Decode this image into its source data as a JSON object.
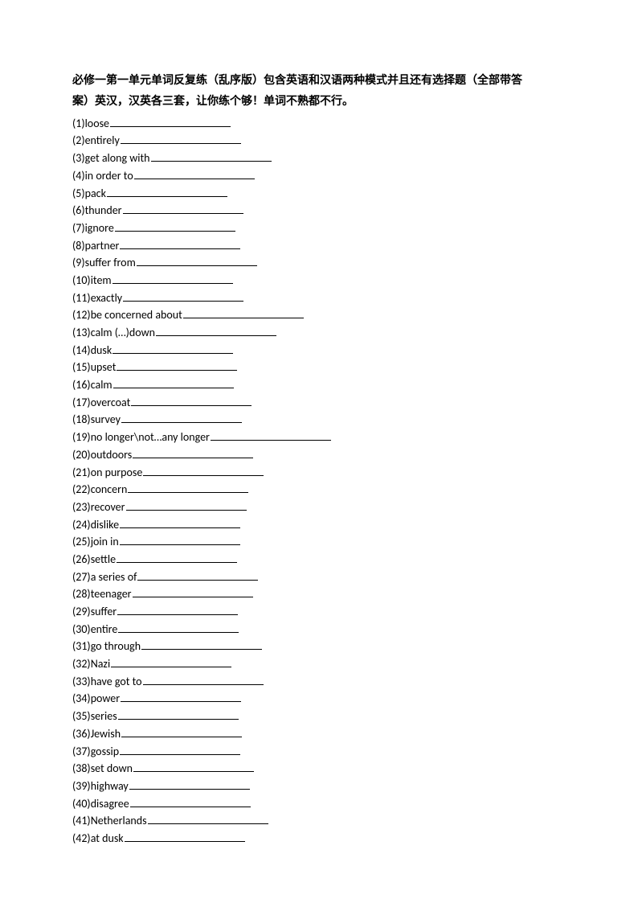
{
  "title_line1": "必修一第一单元单词反复练（乱序版）包含英语和汉语两种模式并且还有选择题（全部带答",
  "title_line2": "案）英汉，汉英各三套，让你练个够！单词不熟都不行。",
  "items": [
    {
      "num": "(1)",
      "word": "loose"
    },
    {
      "num": "(2)",
      "word": "entirely"
    },
    {
      "num": "(3)",
      "word": "get along with"
    },
    {
      "num": "(4)",
      "word": "in order to"
    },
    {
      "num": "(5)",
      "word": "pack"
    },
    {
      "num": "(6)",
      "word": "thunder"
    },
    {
      "num": "(7)",
      "word": "ignore"
    },
    {
      "num": "(8)",
      "word": "partner"
    },
    {
      "num": "(9)",
      "word": "suffer from"
    },
    {
      "num": "(10)",
      "word": "item"
    },
    {
      "num": "(11)",
      "word": "exactly"
    },
    {
      "num": "(12)",
      "word": "be concerned about"
    },
    {
      "num": "(13)",
      "word": "calm (…)down"
    },
    {
      "num": "(14)",
      "word": "dusk"
    },
    {
      "num": "(15)",
      "word": "upset"
    },
    {
      "num": "(16)",
      "word": "calm"
    },
    {
      "num": "(17)",
      "word": "overcoat"
    },
    {
      "num": "(18)",
      "word": "survey"
    },
    {
      "num": "(19)",
      "word": "no longer\\not…any longer"
    },
    {
      "num": "(20)",
      "word": "outdoors"
    },
    {
      "num": "(21)",
      "word": "on purpose"
    },
    {
      "num": "(22)",
      "word": "concern"
    },
    {
      "num": "(23)",
      "word": "recover"
    },
    {
      "num": "(24)",
      "word": "dislike"
    },
    {
      "num": "(25)",
      "word": "join in"
    },
    {
      "num": "(26)",
      "word": "settle"
    },
    {
      "num": "(27)",
      "word": "a series of"
    },
    {
      "num": "(28)",
      "word": "teenager"
    },
    {
      "num": "(29)",
      "word": "suffer"
    },
    {
      "num": "(30)",
      "word": "entire"
    },
    {
      "num": "(31)",
      "word": "go through"
    },
    {
      "num": "(32)",
      "word": "Nazi"
    },
    {
      "num": "(33)",
      "word": "have got to"
    },
    {
      "num": "(34)",
      "word": "power"
    },
    {
      "num": "(35)",
      "word": "series"
    },
    {
      "num": "(36)",
      "word": "Jewish"
    },
    {
      "num": "(37)",
      "word": "gossip"
    },
    {
      "num": "(38)",
      "word": "set down"
    },
    {
      "num": "(39)",
      "word": "highway"
    },
    {
      "num": "(40)",
      "word": "disagree"
    },
    {
      "num": "(41)",
      "word": "Netherlands"
    },
    {
      "num": "(42)",
      "word": "at dusk"
    }
  ]
}
